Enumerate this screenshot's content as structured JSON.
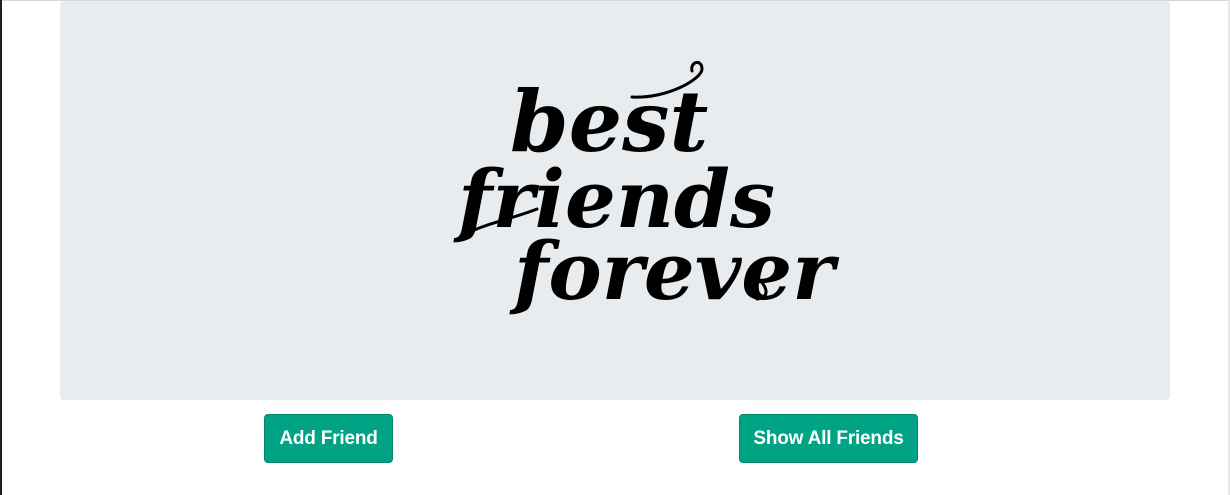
{
  "hero": {
    "image_text": [
      "best",
      "friends",
      "forever"
    ],
    "background_color": "#e9ecef"
  },
  "actions": {
    "add_label": "Add Friend",
    "show_label": "Show All Friends",
    "button_color": "#00a485"
  }
}
